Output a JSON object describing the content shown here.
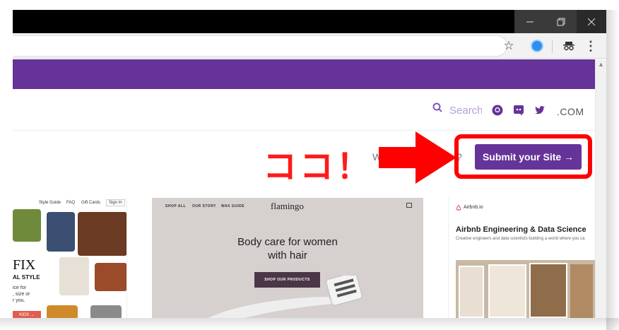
{
  "window": {
    "controls": {
      "minimize": "minimize-icon",
      "maximize": "restore-icon",
      "close": "close-icon"
    }
  },
  "toolbar": {
    "icons": [
      "star-icon",
      "extension-icon",
      "incognito-icon",
      "kebab-menu-icon"
    ]
  },
  "site": {
    "accent_color": "#663399",
    "header": {
      "search_placeholder": "Search",
      "icons": [
        "github-icon",
        "discord-icon",
        "twitter-icon"
      ],
      "com_link": ".COM"
    },
    "cta": {
      "text_left": "W",
      "text_right": "ture ?",
      "submit_label": "Submit your Site →"
    },
    "annotation": {
      "label": "ココ！",
      "color": "#ff0000"
    }
  },
  "showcase": {
    "card1": {
      "nav": [
        "Style Guide",
        "FAQ",
        "Gift Cards"
      ],
      "signin": "Sign In",
      "headline": "FIX",
      "style": "AL STYLE",
      "lines": [
        "ice for",
        ", size or",
        "r you."
      ],
      "kids": "KIDS →"
    },
    "card2": {
      "nav": [
        "SHOP ALL",
        "OUR STORY",
        "WAX GUIDE"
      ],
      "logo": "flamingo",
      "headline_1": "Body care for women",
      "headline_2": "with hair",
      "button": "SHOP OUR PRODUCTS"
    },
    "card3": {
      "logo": "Airbnb.io",
      "title": "Airbnb Engineering & Data Science",
      "subtitle": "Creative engineers and data scientists building a world where you ca"
    }
  }
}
